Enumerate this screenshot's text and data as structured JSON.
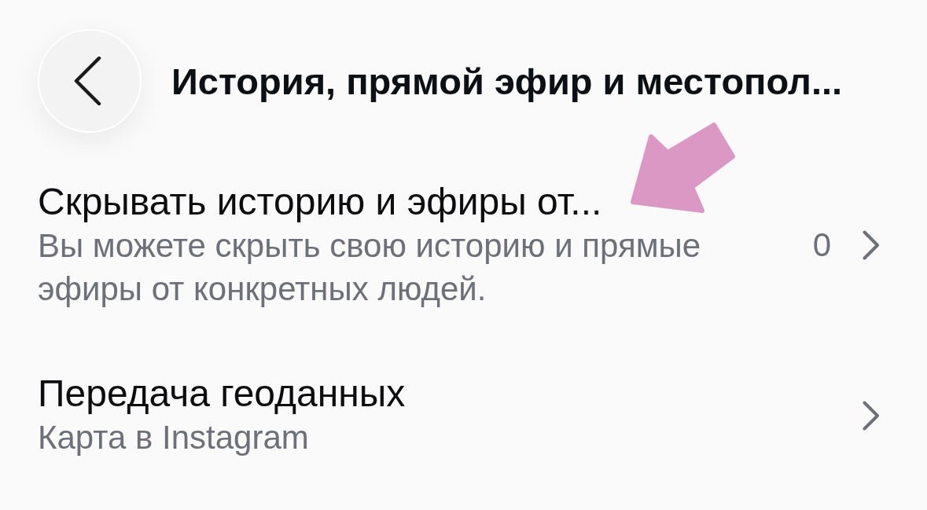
{
  "header": {
    "title": "История, прямой эфир и местопол..."
  },
  "settings": [
    {
      "title": "Скрывать историю и эфиры от...",
      "description": "Вы можете скрыть свою историю и прямые эфиры от конкретных людей.",
      "count": "0"
    },
    {
      "title": "Передача геоданных",
      "description": "Карта в Instagram"
    }
  ]
}
